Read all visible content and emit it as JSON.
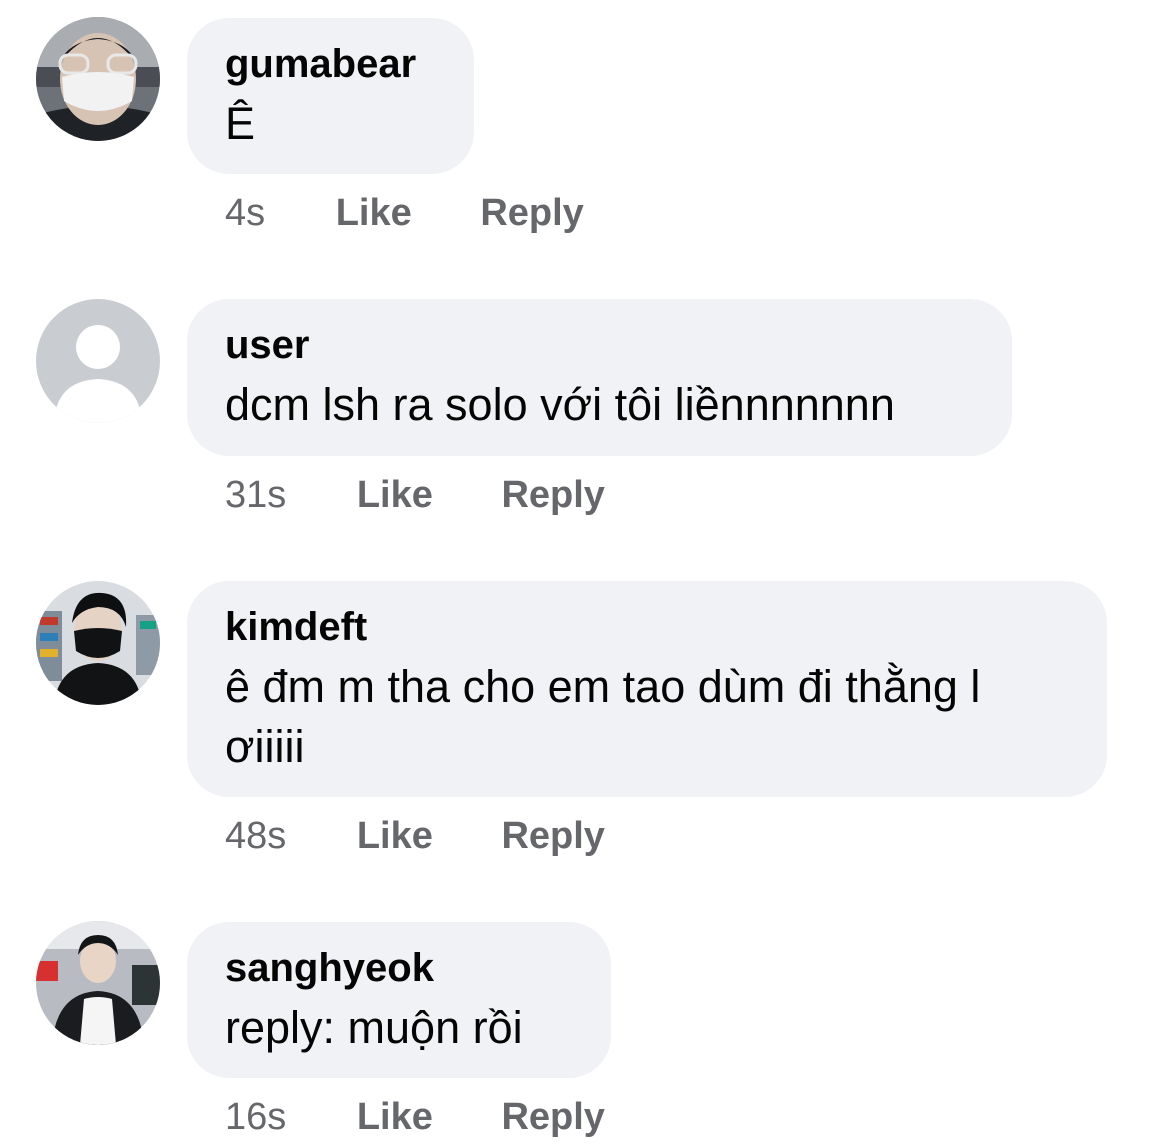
{
  "comments": [
    {
      "author": "gumabear",
      "text": "Ê",
      "time": "4s",
      "like_label": "Like",
      "reply_label": "Reply",
      "avatar": "photo-masked-person-glasses"
    },
    {
      "author": "user",
      "text": "dcm lsh ra solo với tôi liềnnnnnnn",
      "time": "31s",
      "like_label": "Like",
      "reply_label": "Reply",
      "avatar": "default-profile-placeholder"
    },
    {
      "author": "kimdeft",
      "text": "ê đm m tha cho em tao dùm đi thằng l ơiiiii",
      "time": "48s",
      "like_label": "Like",
      "reply_label": "Reply",
      "avatar": "photo-person-black-mask"
    },
    {
      "author": "sanghyeok",
      "text": "reply: muộn rồi",
      "time": "16s",
      "like_label": "Like",
      "reply_label": "Reply",
      "avatar": "photo-person-puffer-jacket"
    }
  ],
  "colors": {
    "bubble": "#f0f2f5",
    "meta_text": "#65676b",
    "body_text": "#050505",
    "placeholder_bg": "#c9ccd1"
  }
}
